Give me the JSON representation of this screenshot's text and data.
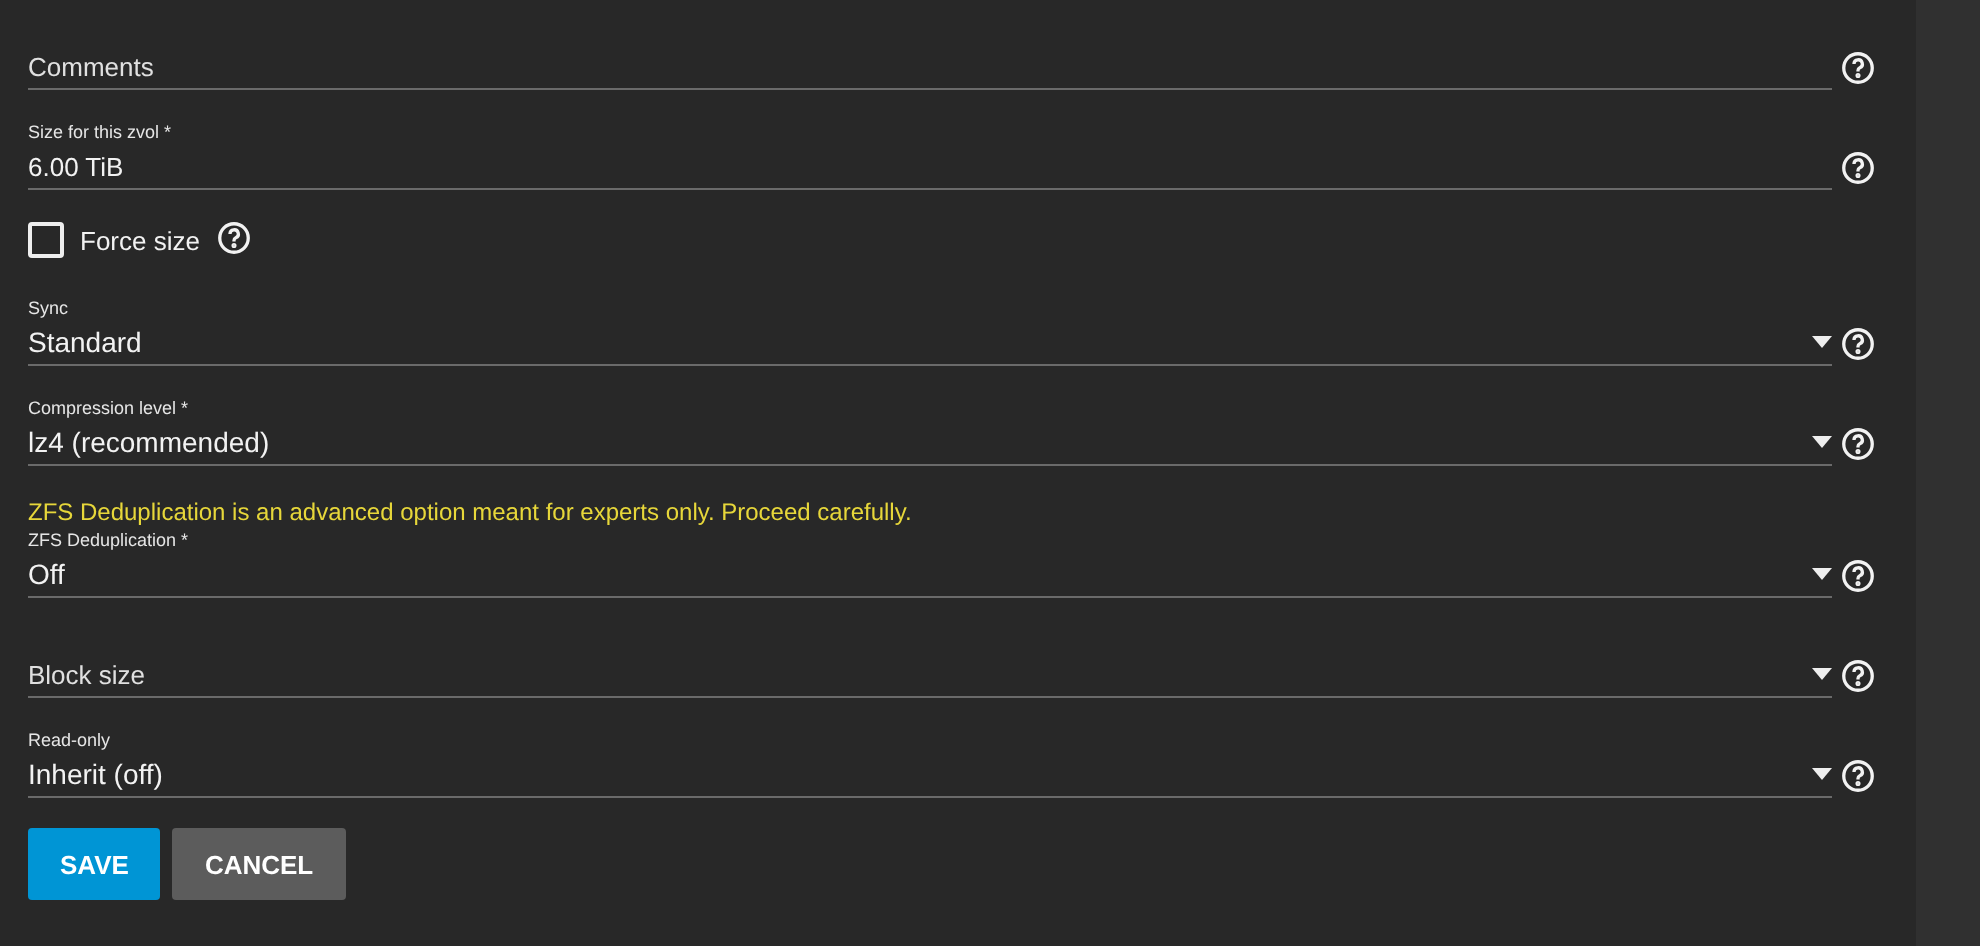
{
  "fields": [
    {
      "kind": "text",
      "placeholder": "Comments"
    },
    {
      "kind": "text",
      "label": "Size for this zvol *",
      "value": "6.00 TiB"
    },
    {
      "kind": "checkbox",
      "label": "Force size",
      "checked": false
    },
    {
      "kind": "select",
      "label": "Sync",
      "value": "Standard"
    },
    {
      "kind": "select",
      "label": "Compression level *",
      "value": "lz4 (recommended)"
    },
    {
      "kind": "warning",
      "text": "ZFS Deduplication is an advanced option meant for experts only. Proceed carefully."
    },
    {
      "kind": "select",
      "label": "ZFS Deduplication *",
      "value": "Off"
    },
    {
      "kind": "select",
      "placeholder": "Block size"
    },
    {
      "kind": "select",
      "label": "Read-only",
      "value": "Inherit (off)"
    }
  ],
  "buttons": [
    {
      "label": "SAVE",
      "kind": "primary"
    },
    {
      "label": "CANCEL",
      "kind": "secondary"
    }
  ]
}
